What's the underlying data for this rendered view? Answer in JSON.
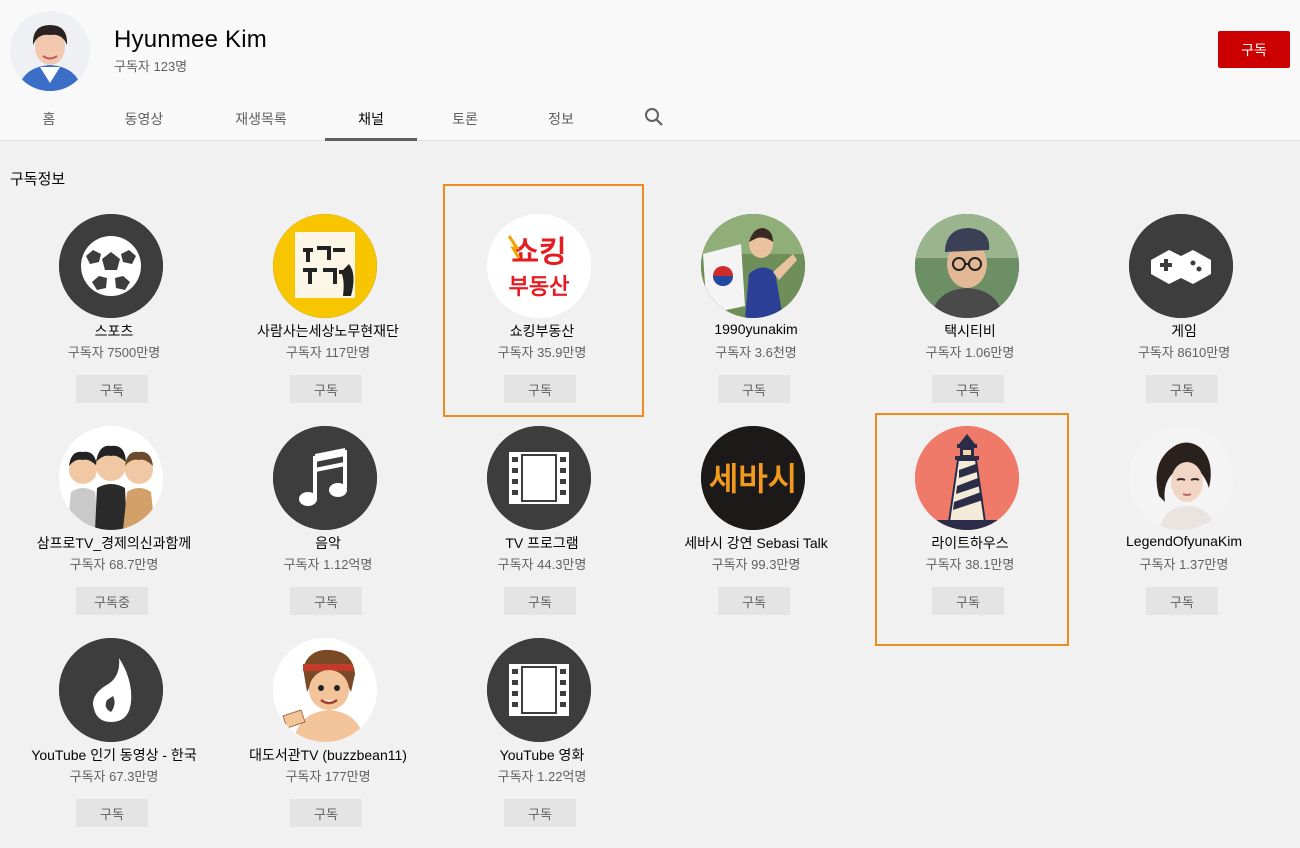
{
  "channel": {
    "title": "Hyunmee Kim",
    "subscribers": "구독자 123명",
    "subscribe_label": "구독"
  },
  "tabs": [
    {
      "label": "홈"
    },
    {
      "label": "동영상"
    },
    {
      "label": "재생목록"
    },
    {
      "label": "채널",
      "active": true
    },
    {
      "label": "토론"
    },
    {
      "label": "정보"
    }
  ],
  "section": {
    "title": "구독정보"
  },
  "channels": [
    {
      "name": "스포츠",
      "subs": "구독자 7500만명",
      "button": "구독",
      "icon": "soccer-ball-icon"
    },
    {
      "name": "사람사는세상노무현재단",
      "subs": "구독자 117만명",
      "button": "구독",
      "icon": "foundation-logo"
    },
    {
      "name": "쇼킹부동산",
      "subs": "구독자 35.9만명",
      "button": "구독",
      "icon": "shocking-realestate-logo",
      "logo_text_1": "쇼킹",
      "logo_text_2": "부동산"
    },
    {
      "name": "1990yunakim",
      "subs": "구독자 3.6천명",
      "button": "구독",
      "icon": "skater-photo"
    },
    {
      "name": "택시티비",
      "subs": "구독자 1.06만명",
      "button": "구독",
      "icon": "person-photo"
    },
    {
      "name": "게임",
      "subs": "구독자 8610만명",
      "button": "구독",
      "icon": "gamepad-icon"
    },
    {
      "name": "삼프로TV_경제의신과함께",
      "subs": "구독자 68.7만명",
      "button": "구독중",
      "icon": "cartoon-hosts-avatar"
    },
    {
      "name": "음악",
      "subs": "구독자 1.12억명",
      "button": "구독",
      "icon": "music-note-icon"
    },
    {
      "name": "TV 프로그램",
      "subs": "구독자 44.3만명",
      "button": "구독",
      "icon": "film-strip-icon"
    },
    {
      "name": "세바시 강연 Sebasi Talk",
      "subs": "구독자 99.3만명",
      "button": "구독",
      "icon": "sebasi-logo",
      "logo_text": "세바시"
    },
    {
      "name": "라이트하우스",
      "subs": "구독자 38.1만명",
      "button": "구독",
      "icon": "lighthouse-icon"
    },
    {
      "name": "LegendOfyunaKim",
      "subs": "구독자 1.37만명",
      "button": "구독",
      "icon": "portrait-photo"
    },
    {
      "name": "YouTube 인기 동영상 - 한국",
      "subs": "구독자 67.3만명",
      "button": "구독",
      "icon": "trending-flame-icon"
    },
    {
      "name": "대도서관TV (buzzbean11)",
      "subs": "구독자 177만명",
      "button": "구독",
      "icon": "cartoon-avatar"
    },
    {
      "name": "YouTube 영화",
      "subs": "구독자 1.22억명",
      "button": "구독",
      "icon": "film-strip-icon"
    }
  ],
  "colors": {
    "subscribe_red": "#cc0000",
    "highlight_orange": "#f08c1e",
    "icon_bg": "#3d3d3d"
  }
}
